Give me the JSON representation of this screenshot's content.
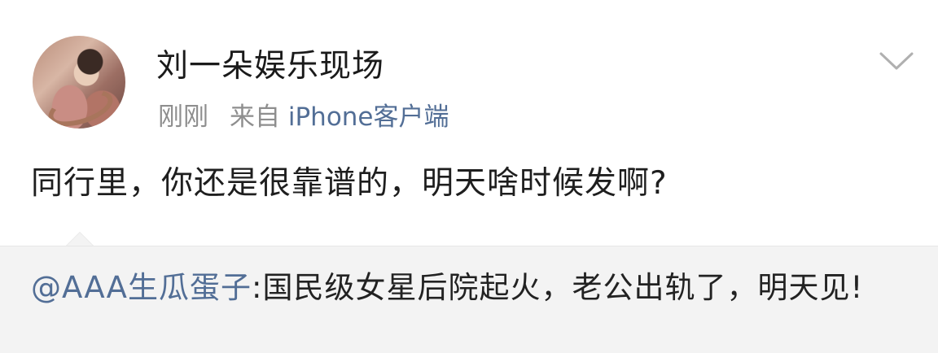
{
  "post": {
    "username": "刘一朵娱乐现场",
    "time": "刚刚",
    "source_prefix": "来自",
    "source": "iPhone客户端",
    "content": "同行里，你还是很靠谱的，明天啥时候发啊?"
  },
  "quoted": {
    "mention": "@AAA生瓜蛋子",
    "text": ":国民级女星后院起火，老公出轨了，明天见!"
  },
  "colors": {
    "link": "#526e96",
    "meta": "#8e8e8e",
    "quote_bg": "#f3f3f3"
  },
  "icons": {
    "avatar": "avatar-photo",
    "menu": "chevron-down-icon"
  }
}
